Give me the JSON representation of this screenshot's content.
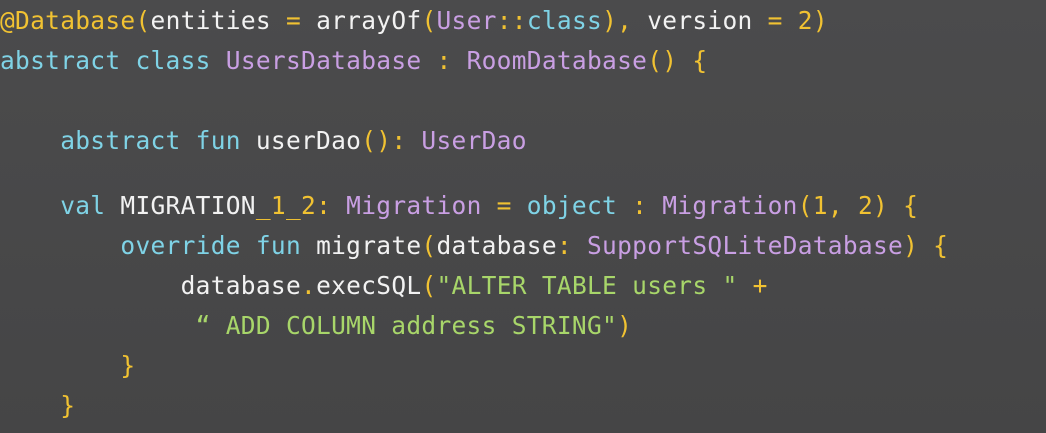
{
  "code": {
    "lines": [
      {
        "text": "@Database(entities = arrayOf(User::class), version = 2)",
        "tokens": [
          {
            "t": "@Database",
            "k": "ann"
          },
          {
            "t": "(",
            "k": "pun"
          },
          {
            "t": "entities",
            "k": "id"
          },
          {
            "t": " = ",
            "k": "pun"
          },
          {
            "t": "arrayOf",
            "k": "id"
          },
          {
            "t": "(",
            "k": "pun"
          },
          {
            "t": "User",
            "k": "typ"
          },
          {
            "t": "::",
            "k": "pun"
          },
          {
            "t": "class",
            "k": "kw"
          },
          {
            "t": "), ",
            "k": "pun"
          },
          {
            "t": "version",
            "k": "id"
          },
          {
            "t": " = ",
            "k": "pun"
          },
          {
            "t": "2",
            "k": "num"
          },
          {
            "t": ")",
            "k": "pun"
          }
        ]
      },
      {
        "text": "abstract class UsersDatabase : RoomDatabase() {",
        "tokens": [
          {
            "t": "abstract class ",
            "k": "kw"
          },
          {
            "t": "UsersDatabase",
            "k": "typ"
          },
          {
            "t": " : ",
            "k": "pun"
          },
          {
            "t": "RoomDatabase",
            "k": "typ"
          },
          {
            "t": "() {",
            "k": "pun"
          }
        ]
      },
      {
        "text": "    abstract fun userDao(): UserDao",
        "tokens": [
          {
            "t": "    ",
            "k": "id"
          },
          {
            "t": "abstract fun ",
            "k": "kw"
          },
          {
            "t": "userDao",
            "k": "id"
          },
          {
            "t": "(): ",
            "k": "pun"
          },
          {
            "t": "UserDao",
            "k": "typ"
          }
        ]
      },
      {
        "text": "    val MIGRATION_1_2: Migration = object : Migration(1, 2) {",
        "tokens": [
          {
            "t": "    ",
            "k": "id"
          },
          {
            "t": "val ",
            "k": "kw"
          },
          {
            "t": "MIGRATION",
            "k": "id"
          },
          {
            "t": "_1_2",
            "k": "num"
          },
          {
            "t": ": ",
            "k": "pun"
          },
          {
            "t": "Migration",
            "k": "typ"
          },
          {
            "t": " = ",
            "k": "pun"
          },
          {
            "t": "object",
            "k": "kw"
          },
          {
            "t": " : ",
            "k": "pun"
          },
          {
            "t": "Migration",
            "k": "typ"
          },
          {
            "t": "(",
            "k": "pun"
          },
          {
            "t": "1",
            "k": "num"
          },
          {
            "t": ", ",
            "k": "pun"
          },
          {
            "t": "2",
            "k": "num"
          },
          {
            "t": ") {",
            "k": "pun"
          }
        ]
      },
      {
        "text": "        override fun migrate(database: SupportSQLiteDatabase) {",
        "tokens": [
          {
            "t": "        ",
            "k": "id"
          },
          {
            "t": "override fun ",
            "k": "kw"
          },
          {
            "t": "migrate",
            "k": "id"
          },
          {
            "t": "(",
            "k": "pun"
          },
          {
            "t": "database",
            "k": "id"
          },
          {
            "t": ": ",
            "k": "pun"
          },
          {
            "t": "SupportSQLiteDatabase",
            "k": "typ"
          },
          {
            "t": ") {",
            "k": "pun"
          }
        ]
      },
      {
        "text": "            database.execSQL(\"ALTER TABLE users \" +",
        "tokens": [
          {
            "t": "            ",
            "k": "id"
          },
          {
            "t": "database",
            "k": "id"
          },
          {
            "t": ".",
            "k": "pun"
          },
          {
            "t": "execSQL",
            "k": "id"
          },
          {
            "t": "(",
            "k": "pun"
          },
          {
            "t": "\"ALTER TABLE users \"",
            "k": "str"
          },
          {
            "t": " +",
            "k": "pun"
          }
        ]
      },
      {
        "text": "             “ ADD COLUMN address STRING\")",
        "tokens": [
          {
            "t": "             ",
            "k": "id"
          },
          {
            "t": "“ ADD COLUMN address STRING\"",
            "k": "str"
          },
          {
            "t": ")",
            "k": "pun"
          }
        ]
      },
      {
        "text": "        }",
        "tokens": [
          {
            "t": "        ",
            "k": "id"
          },
          {
            "t": "}",
            "k": "pun"
          }
        ]
      },
      {
        "text": "    }",
        "tokens": [
          {
            "t": "    ",
            "k": "id"
          },
          {
            "t": "}",
            "k": "pun"
          }
        ]
      }
    ]
  }
}
